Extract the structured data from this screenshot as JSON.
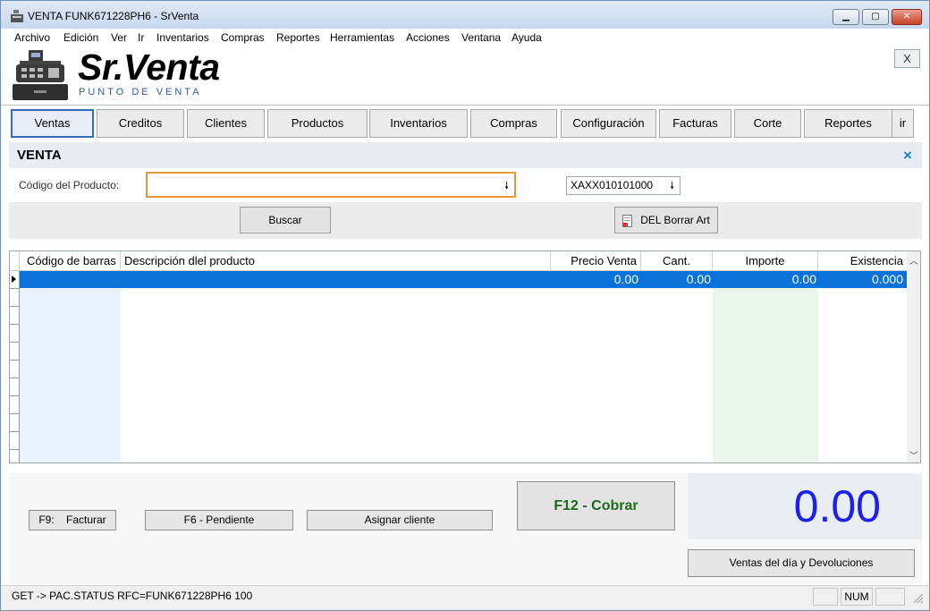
{
  "window": {
    "title": "VENTA FUNK671228PH6 - SrVenta"
  },
  "menu": [
    "Archivo",
    "Edición",
    "Ver",
    "Ir",
    "Inventarios",
    "Compras",
    "Reportes",
    "Herramientas",
    "Acciones",
    "Ventana",
    "Ayuda"
  ],
  "brand": {
    "name": "Sr.Venta",
    "tagline": "PUNTO DE VENTA",
    "close_label": "X"
  },
  "nav": [
    "Ventas",
    "Creditos",
    "Clientes",
    "Productos",
    "Inventarios",
    "Compras",
    "Configuración",
    "Facturas",
    "Corte",
    "Reportes",
    "ir"
  ],
  "section": {
    "title": "VENTA",
    "close_glyph": "×"
  },
  "product_form": {
    "code_label": "Código del Producto:",
    "code_value": "",
    "rfc_value": "XAXX010101000",
    "search_button": "Buscar",
    "delete_button": "DEL Borrar Art"
  },
  "grid": {
    "columns": [
      "Código de barras",
      "Descripción dlel producto",
      "Precio Venta",
      "Cant.",
      "Importe",
      "Existencia"
    ],
    "rows": [
      {
        "codigo": "",
        "descripcion": "",
        "precio": "0.00",
        "cantidad": "0.00",
        "importe": "0.00",
        "existencia": "0.000"
      }
    ]
  },
  "actions": {
    "facturar": "F9:    Facturar",
    "pendiente": "F6 - Pendiente",
    "asignar": "Asignar cliente",
    "cobrar": "F12 - Cobrar",
    "ventas_dia": "Ventas del día y Devoluciones"
  },
  "total": "0.00",
  "status": {
    "text": "GET -> PAC.STATUS RFC=FUNK671228PH6 100",
    "num": "NUM"
  }
}
